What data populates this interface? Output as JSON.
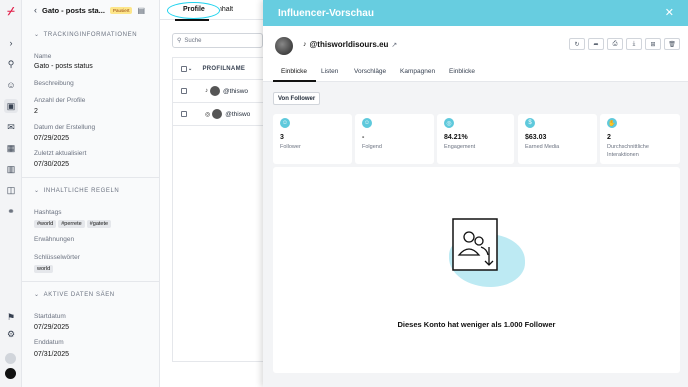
{
  "rail": {
    "icons": [
      "logo-icon",
      "chevron-right-icon",
      "users-search-icon",
      "user-icon",
      "image-icon",
      "mail-icon",
      "calendar-icon",
      "bar-chart-icon",
      "megaphone-icon",
      "link-icon",
      "flag-icon",
      "settings-icon"
    ]
  },
  "panel": {
    "title": "Gato - posts sta...",
    "status_badge": "Pausiert",
    "section_tracking": "TRACKINGINFORMATIONEN",
    "name_label": "Name",
    "name_value": "Gato - posts status",
    "description_label": "Beschreibung",
    "profile_count_label": "Anzahl der Profile",
    "profile_count_value": "2",
    "created_label": "Datum der Erstellung",
    "created_value": "07/29/2025",
    "updated_label": "Zuletzt aktualisiert",
    "updated_value": "07/30/2025",
    "section_rules": "INHALTLICHE REGELN",
    "hashtags_label": "Hashtags",
    "hashtags": [
      "#world",
      "#perrete",
      "#gatete"
    ],
    "mentions_label": "Erwähnungen",
    "keywords_label": "Schlüsselwörter",
    "keywords": [
      "world"
    ],
    "section_dates": "AKTIVE DATEN SÄEN",
    "start_label": "Startdatum",
    "start_value": "07/29/2025",
    "end_label": "Enddatum",
    "end_value": "07/31/2025"
  },
  "mid": {
    "tab_profiles": "Profile",
    "tab_content": "Inhalt",
    "search_placeholder": "Suche",
    "col_profile": "PROFILNAME",
    "rows": [
      {
        "network": "tiktok-icon",
        "name": "@thiswo"
      },
      {
        "network": "instagram-icon",
        "name": "@thiswo"
      }
    ]
  },
  "preview": {
    "title": "Influencer-Vorschau",
    "handle": "@thisworldisours.eu",
    "tabs": [
      "Einblicke",
      "Listen",
      "Vorschläge",
      "Kampagnen",
      "Einblicke"
    ],
    "filter_label": "Von Follower",
    "stats": [
      {
        "icon": "users-icon",
        "value": "3",
        "label": "Follower"
      },
      {
        "icon": "user-follow-icon",
        "value": "-",
        "label": "Folgend"
      },
      {
        "icon": "target-icon",
        "value": "84.21%",
        "label": "Engagement"
      },
      {
        "icon": "dollar-icon",
        "value": "$63.03",
        "label": "Earned Media"
      },
      {
        "icon": "hand-icon",
        "value": "2",
        "label": "Durchschnittliche Interaktionen"
      }
    ],
    "empty_message": "Dieses Konto hat weniger als 1.000 Follower"
  },
  "colors": {
    "accent": "#67cde0",
    "brand": "#e11d48",
    "paused": "#fde68a"
  }
}
